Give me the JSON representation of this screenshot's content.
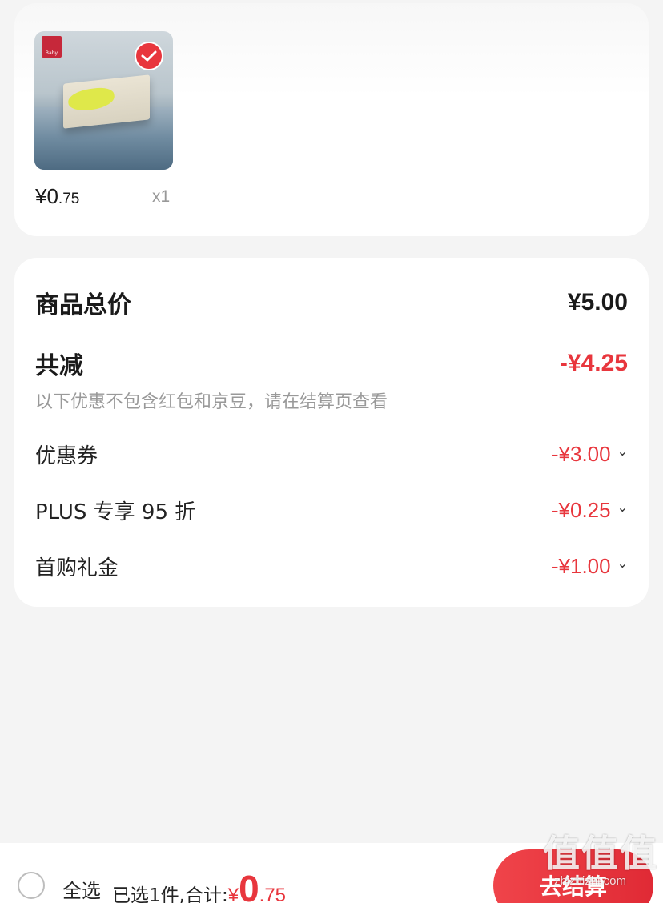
{
  "product": {
    "price_main": "¥0",
    "price_decimal": ".75",
    "quantity": "x1",
    "selected": true,
    "image_brand_text": "Baby"
  },
  "summary": {
    "total_label": "商品总价",
    "total_value": "¥5.00",
    "reduce_label": "共减",
    "reduce_value": "-¥4.25",
    "note": "以下优惠不包含红包和京豆，请在结算页查看",
    "items": [
      {
        "label": "优惠券",
        "value": "-¥3.00"
      },
      {
        "label": "PLUS 专享 95 折",
        "value": "-¥0.25"
      },
      {
        "label": "首购礼金",
        "value": "-¥1.00"
      }
    ]
  },
  "bottom_bar": {
    "select_all_label": "全选",
    "selected_text": "已选1件,合计:",
    "currency": "¥",
    "total_int": "0",
    "total_dec": ".75",
    "checkout_label": "去结算"
  },
  "watermark": {
    "glyphs": "值值值",
    "site": "zhizhizhi.com"
  },
  "colors": {
    "accent": "#e8363d",
    "background": "#f4f4f4",
    "card": "#ffffff",
    "muted": "#999999"
  }
}
